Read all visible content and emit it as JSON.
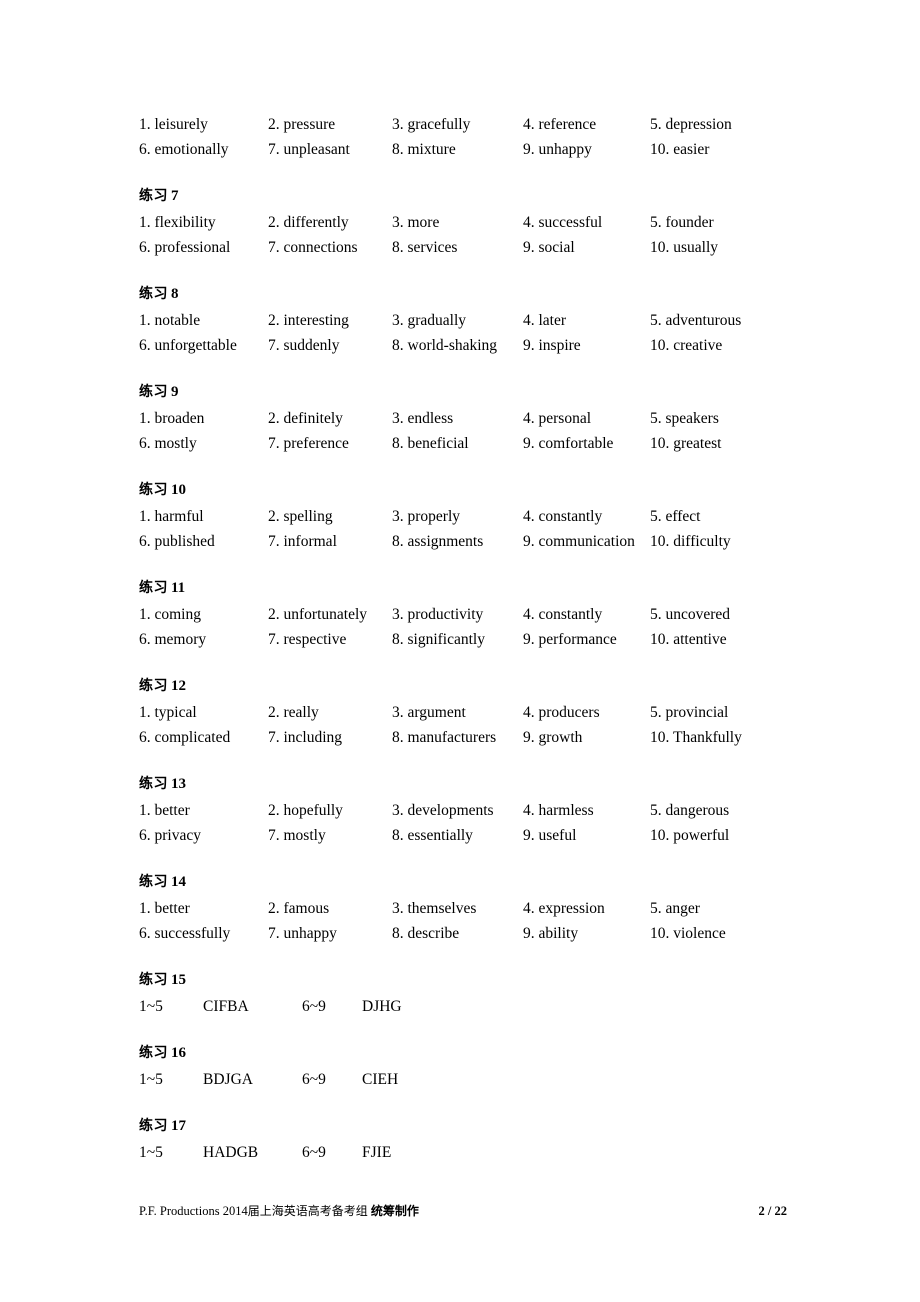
{
  "document": {
    "heading_prefix": "练习",
    "footer": {
      "credit_latin": "P.F. Productions 2014",
      "credit_cn_plain": "届上海英语高考备考组",
      "credit_cn_bold": "统筹制作",
      "page_label": "2 / 22"
    }
  },
  "blocks": [
    {
      "id": "block-continued",
      "heading_number": "",
      "has_heading": false,
      "type": "words",
      "rows": [
        [
          "1. leisurely",
          "2. pressure",
          "3. gracefully",
          "4. reference",
          "5. depression"
        ],
        [
          "6. emotionally",
          "7. unpleasant",
          "8. mixture",
          "9. unhappy",
          "10. easier"
        ]
      ]
    },
    {
      "id": "block-7",
      "heading_number": "7",
      "has_heading": true,
      "type": "words",
      "rows": [
        [
          "1. flexibility",
          "2. differently",
          "3. more",
          "4. successful",
          "5. founder"
        ],
        [
          "6. professional",
          "7. connections",
          "8. services",
          "9. social",
          "10. usually"
        ]
      ]
    },
    {
      "id": "block-8",
      "heading_number": "8",
      "has_heading": true,
      "type": "words",
      "rows": [
        [
          "1. notable",
          "2. interesting",
          "3. gradually",
          "4. later",
          "5. adventurous"
        ],
        [
          "6. unforgettable",
          "7. suddenly",
          "8. world-shaking",
          "9. inspire",
          "10. creative"
        ]
      ]
    },
    {
      "id": "block-9",
      "heading_number": "9",
      "has_heading": true,
      "type": "words",
      "rows": [
        [
          "1. broaden",
          "2. definitely",
          "3. endless",
          "4. personal",
          "5. speakers"
        ],
        [
          "6. mostly",
          "7. preference",
          "8. beneficial",
          "9. comfortable",
          "10. greatest"
        ]
      ]
    },
    {
      "id": "block-10",
      "heading_number": "10",
      "has_heading": true,
      "type": "words",
      "rows": [
        [
          "1. harmful",
          "2. spelling",
          "3. properly",
          "4. constantly",
          "5. effect"
        ],
        [
          "6. published",
          "7. informal",
          "8. assignments",
          "9. communication",
          "10. difficulty"
        ]
      ]
    },
    {
      "id": "block-11",
      "heading_number": "11",
      "has_heading": true,
      "type": "words",
      "rows": [
        [
          "1. coming",
          "2. unfortunately",
          "3. productivity",
          "4. constantly",
          "5. uncovered"
        ],
        [
          "6. memory",
          "7. respective",
          "8. significantly",
          "9. performance",
          "10. attentive"
        ]
      ]
    },
    {
      "id": "block-12",
      "heading_number": "12",
      "has_heading": true,
      "type": "words",
      "rows": [
        [
          "1. typical",
          "2. really",
          "3. argument",
          "4. producers",
          "5. provincial"
        ],
        [
          "6. complicated",
          "7. including",
          "8. manufacturers",
          "9. growth",
          "10. Thankfully"
        ]
      ]
    },
    {
      "id": "block-13",
      "heading_number": "13",
      "has_heading": true,
      "type": "words",
      "rows": [
        [
          "1. better",
          "2. hopefully",
          "3. developments",
          "4. harmless",
          "5. dangerous"
        ],
        [
          "6. privacy",
          "7. mostly",
          "8. essentially",
          "9. useful",
          "10. powerful"
        ]
      ]
    },
    {
      "id": "block-14",
      "heading_number": "14",
      "has_heading": true,
      "type": "words",
      "rows": [
        [
          "1. better",
          "2. famous",
          "3. themselves",
          "4. expression",
          "5. anger"
        ],
        [
          "6. successfully",
          "7. unhappy",
          "8. describe",
          "9. ability",
          "10. violence"
        ]
      ]
    },
    {
      "id": "block-15",
      "heading_number": "15",
      "has_heading": true,
      "type": "letters",
      "rows": [
        [
          "1~5",
          "CIFBA",
          "6~9",
          "DJHG"
        ]
      ]
    },
    {
      "id": "block-16",
      "heading_number": "16",
      "has_heading": true,
      "type": "letters",
      "rows": [
        [
          "1~5",
          "BDJGA",
          "6~9",
          "CIEH"
        ]
      ]
    },
    {
      "id": "block-17",
      "heading_number": "17",
      "has_heading": true,
      "type": "letters",
      "rows": [
        [
          "1~5",
          "HADGB",
          "6~9",
          "FJIE"
        ]
      ]
    }
  ]
}
